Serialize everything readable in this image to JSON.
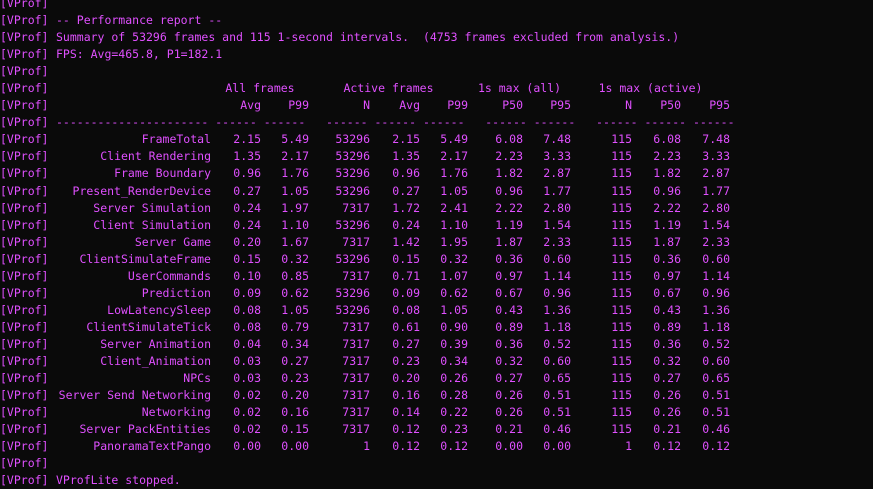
{
  "tag": "[VProf]",
  "title_line": "-- Performance report --",
  "summary_line": "Summary of 53296 frames and 115 1-second intervals.  (4753 frames excluded from analysis.)",
  "fps_line": "FPS: Avg=465.8, P1=182.1",
  "groups": [
    "All frames",
    "Active frames",
    "1s max (all)",
    "1s max (active)"
  ],
  "columns": [
    "Avg",
    "P99",
    "N",
    "Avg",
    "P99",
    "P50",
    "P95",
    "N",
    "P50",
    "P95"
  ],
  "separator": "---------------------- ------ ------   ------ ------ ------   ------ ------   ------ ------ ------",
  "rows": [
    {
      "name": "FrameTotal",
      "v": [
        "2.15",
        "5.49",
        "53296",
        "2.15",
        "5.49",
        "6.08",
        "7.48",
        "115",
        "6.08",
        "7.48"
      ]
    },
    {
      "name": "Client Rendering",
      "v": [
        "1.35",
        "2.17",
        "53296",
        "1.35",
        "2.17",
        "2.23",
        "3.33",
        "115",
        "2.23",
        "3.33"
      ]
    },
    {
      "name": "Frame Boundary",
      "v": [
        "0.96",
        "1.76",
        "53296",
        "0.96",
        "1.76",
        "1.82",
        "2.87",
        "115",
        "1.82",
        "2.87"
      ]
    },
    {
      "name": "Present_RenderDevice",
      "v": [
        "0.27",
        "1.05",
        "53296",
        "0.27",
        "1.05",
        "0.96",
        "1.77",
        "115",
        "0.96",
        "1.77"
      ]
    },
    {
      "name": "Server Simulation",
      "v": [
        "0.24",
        "1.97",
        "7317",
        "1.72",
        "2.41",
        "2.22",
        "2.80",
        "115",
        "2.22",
        "2.80"
      ]
    },
    {
      "name": "Client Simulation",
      "v": [
        "0.24",
        "1.10",
        "53296",
        "0.24",
        "1.10",
        "1.19",
        "1.54",
        "115",
        "1.19",
        "1.54"
      ]
    },
    {
      "name": "Server Game",
      "v": [
        "0.20",
        "1.67",
        "7317",
        "1.42",
        "1.95",
        "1.87",
        "2.33",
        "115",
        "1.87",
        "2.33"
      ]
    },
    {
      "name": "ClientSimulateFrame",
      "v": [
        "0.15",
        "0.32",
        "53296",
        "0.15",
        "0.32",
        "0.36",
        "0.60",
        "115",
        "0.36",
        "0.60"
      ]
    },
    {
      "name": "UserCommands",
      "v": [
        "0.10",
        "0.85",
        "7317",
        "0.71",
        "1.07",
        "0.97",
        "1.14",
        "115",
        "0.97",
        "1.14"
      ]
    },
    {
      "name": "Prediction",
      "v": [
        "0.09",
        "0.62",
        "53296",
        "0.09",
        "0.62",
        "0.67",
        "0.96",
        "115",
        "0.67",
        "0.96"
      ]
    },
    {
      "name": "LowLatencySleep",
      "v": [
        "0.08",
        "1.05",
        "53296",
        "0.08",
        "1.05",
        "0.43",
        "1.36",
        "115",
        "0.43",
        "1.36"
      ]
    },
    {
      "name": "ClientSimulateTick",
      "v": [
        "0.08",
        "0.79",
        "7317",
        "0.61",
        "0.90",
        "0.89",
        "1.18",
        "115",
        "0.89",
        "1.18"
      ]
    },
    {
      "name": "Server Animation",
      "v": [
        "0.04",
        "0.34",
        "7317",
        "0.27",
        "0.39",
        "0.36",
        "0.52",
        "115",
        "0.36",
        "0.52"
      ]
    },
    {
      "name": "Client_Animation",
      "v": [
        "0.03",
        "0.27",
        "7317",
        "0.23",
        "0.34",
        "0.32",
        "0.60",
        "115",
        "0.32",
        "0.60"
      ]
    },
    {
      "name": "NPCs",
      "v": [
        "0.03",
        "0.23",
        "7317",
        "0.20",
        "0.26",
        "0.27",
        "0.65",
        "115",
        "0.27",
        "0.65"
      ]
    },
    {
      "name": "Server Send Networking",
      "v": [
        "0.02",
        "0.20",
        "7317",
        "0.16",
        "0.28",
        "0.26",
        "0.51",
        "115",
        "0.26",
        "0.51"
      ]
    },
    {
      "name": "Networking",
      "v": [
        "0.02",
        "0.16",
        "7317",
        "0.14",
        "0.22",
        "0.26",
        "0.51",
        "115",
        "0.26",
        "0.51"
      ]
    },
    {
      "name": "Server PackEntities",
      "v": [
        "0.02",
        "0.15",
        "7317",
        "0.12",
        "0.23",
        "0.21",
        "0.46",
        "115",
        "0.21",
        "0.46"
      ]
    },
    {
      "name": "PanoramaTextPango",
      "v": [
        "0.00",
        "0.00",
        "1",
        "0.12",
        "0.12",
        "0.00",
        "0.00",
        "1",
        "0.12",
        "0.12"
      ]
    }
  ],
  "stopped_line": "VProfLite stopped.",
  "colors": {
    "text": "#e050ff",
    "background": "#0a0a0a"
  }
}
